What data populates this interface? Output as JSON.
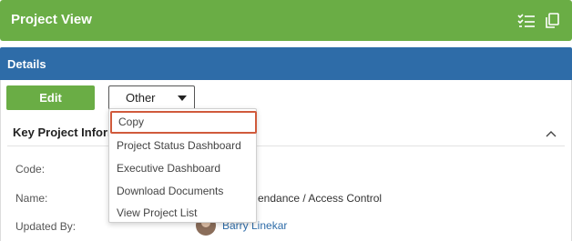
{
  "header": {
    "title": "Project View",
    "icons": [
      "checklist-icon",
      "copy-icon"
    ]
  },
  "details": {
    "title": "Details"
  },
  "actions": {
    "edit_label": "Edit",
    "other_label": "Other"
  },
  "dropdown": {
    "items": [
      "Copy",
      "Project Status Dashboard",
      "Executive Dashboard",
      "Download Documents",
      "View Project List"
    ],
    "highlighted": "Copy"
  },
  "section": {
    "title": "Key Project Inform"
  },
  "fields": {
    "code_label": "Code:",
    "name_label": "Name:",
    "name_value": "endance / Access Control",
    "updated_by_label": "Updated By:",
    "updated_by_value": "Barry Linekar"
  },
  "colors": {
    "header_green": "#6aad45",
    "details_blue": "#2e6ca8",
    "highlight_border": "#d05a3c",
    "link_blue": "#2e6ca8"
  }
}
